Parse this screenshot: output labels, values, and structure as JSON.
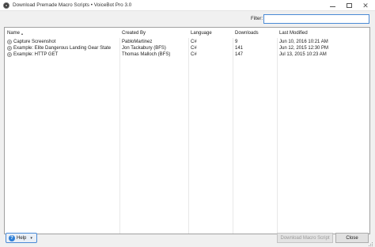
{
  "window": {
    "title": "Download Premade Macro Scripts • VoiceBot Pro 3.0",
    "icon": "voicebot-app-icon",
    "controls": {
      "minimize": "minimize-icon",
      "maximize": "maximize-icon",
      "close": "✕"
    }
  },
  "filter": {
    "label": "Filter:",
    "value": ""
  },
  "table": {
    "columns": [
      "Name",
      "Created By",
      "Language",
      "Downloads",
      "Last Modified"
    ],
    "sort": {
      "column": "Name",
      "indicator": "▲"
    },
    "rows": [
      {
        "name": "Capture Screenshot",
        "created_by": "PabloMartinez",
        "language": "C#",
        "downloads": "9",
        "last_modified": "Jun 10, 2016 10:21 AM"
      },
      {
        "name": "Example: Elite Dangerous Landing Gear State",
        "created_by": "Jon Tackabury (BFS)",
        "language": "C#",
        "downloads": "141",
        "last_modified": "Jun 12, 2015 12:30 PM"
      },
      {
        "name": "Example: HTTP GET",
        "created_by": "Thomas Malloch (BFS)",
        "language": "C#",
        "downloads": "147",
        "last_modified": "Jul 13, 2015 10:23 AM"
      }
    ]
  },
  "footer": {
    "help_label": "Help",
    "help_caret": "▾",
    "help_icon_glyph": "?",
    "download_label": "Download Macro Script",
    "close_label": "Close"
  },
  "colors": {
    "accent": "#4a8ad6",
    "help_icon": "#2e7fd6",
    "disabled_text": "#9a9a9a"
  }
}
